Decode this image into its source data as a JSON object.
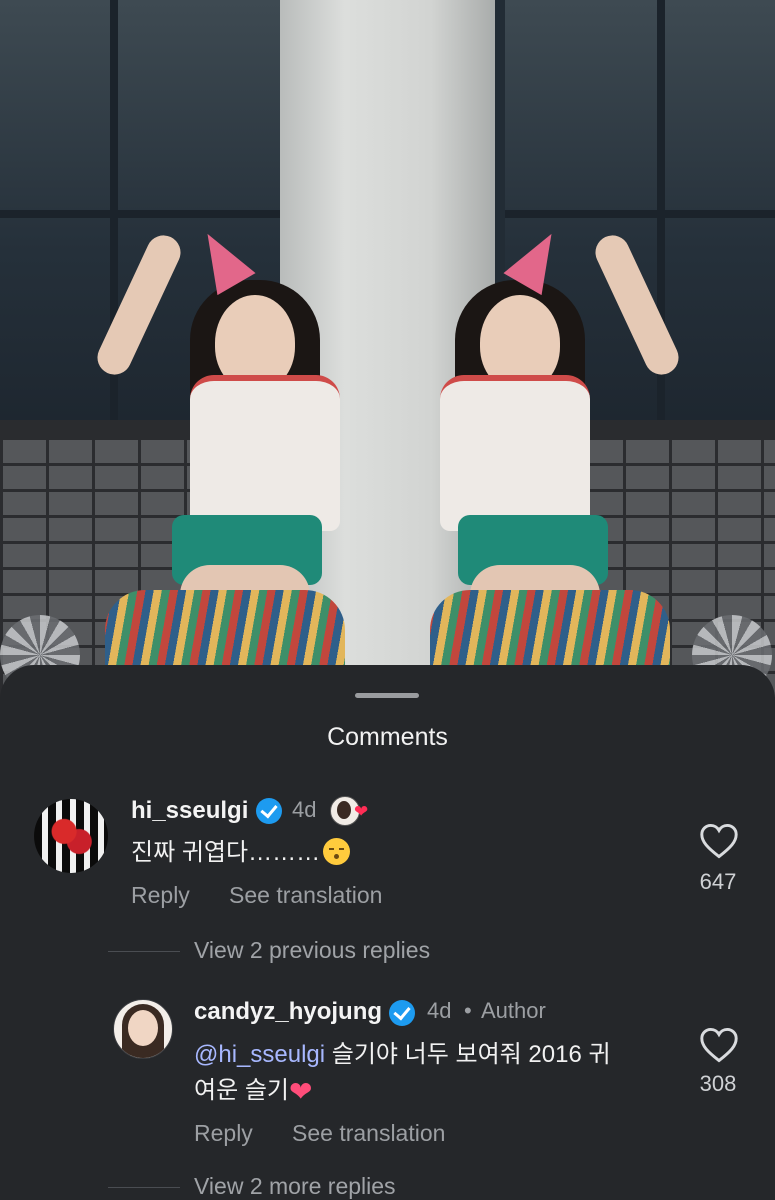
{
  "photo": {
    "description_icon": "mirrored-photo"
  },
  "sheet": {
    "title": "Comments"
  },
  "comments": [
    {
      "username": "hi_sseulgi",
      "time": "4d",
      "text": "진짜 귀엽다………",
      "emoji": "kissing-face",
      "actions": {
        "reply": "Reply",
        "translate": "See translation"
      },
      "likes": "647"
    },
    {
      "username": "candyz_hyojung",
      "time": "4d",
      "separator": "•",
      "role": "Author",
      "mention": "@hi_sseulgi",
      "text_line1": " 슬기야 너두 보여줘 2016 귀",
      "text_line2": "여운 슬기",
      "emoji": "heart",
      "actions": {
        "reply": "Reply",
        "translate": "See translation"
      },
      "likes": "308"
    }
  ],
  "threads": {
    "previous": "View 2 previous replies",
    "more": "View 2 more replies"
  },
  "colors": {
    "sheet": "#25272a",
    "verified": "#1d9bf0",
    "mention": "#a8b8ff",
    "heart": "#ff2d55"
  }
}
